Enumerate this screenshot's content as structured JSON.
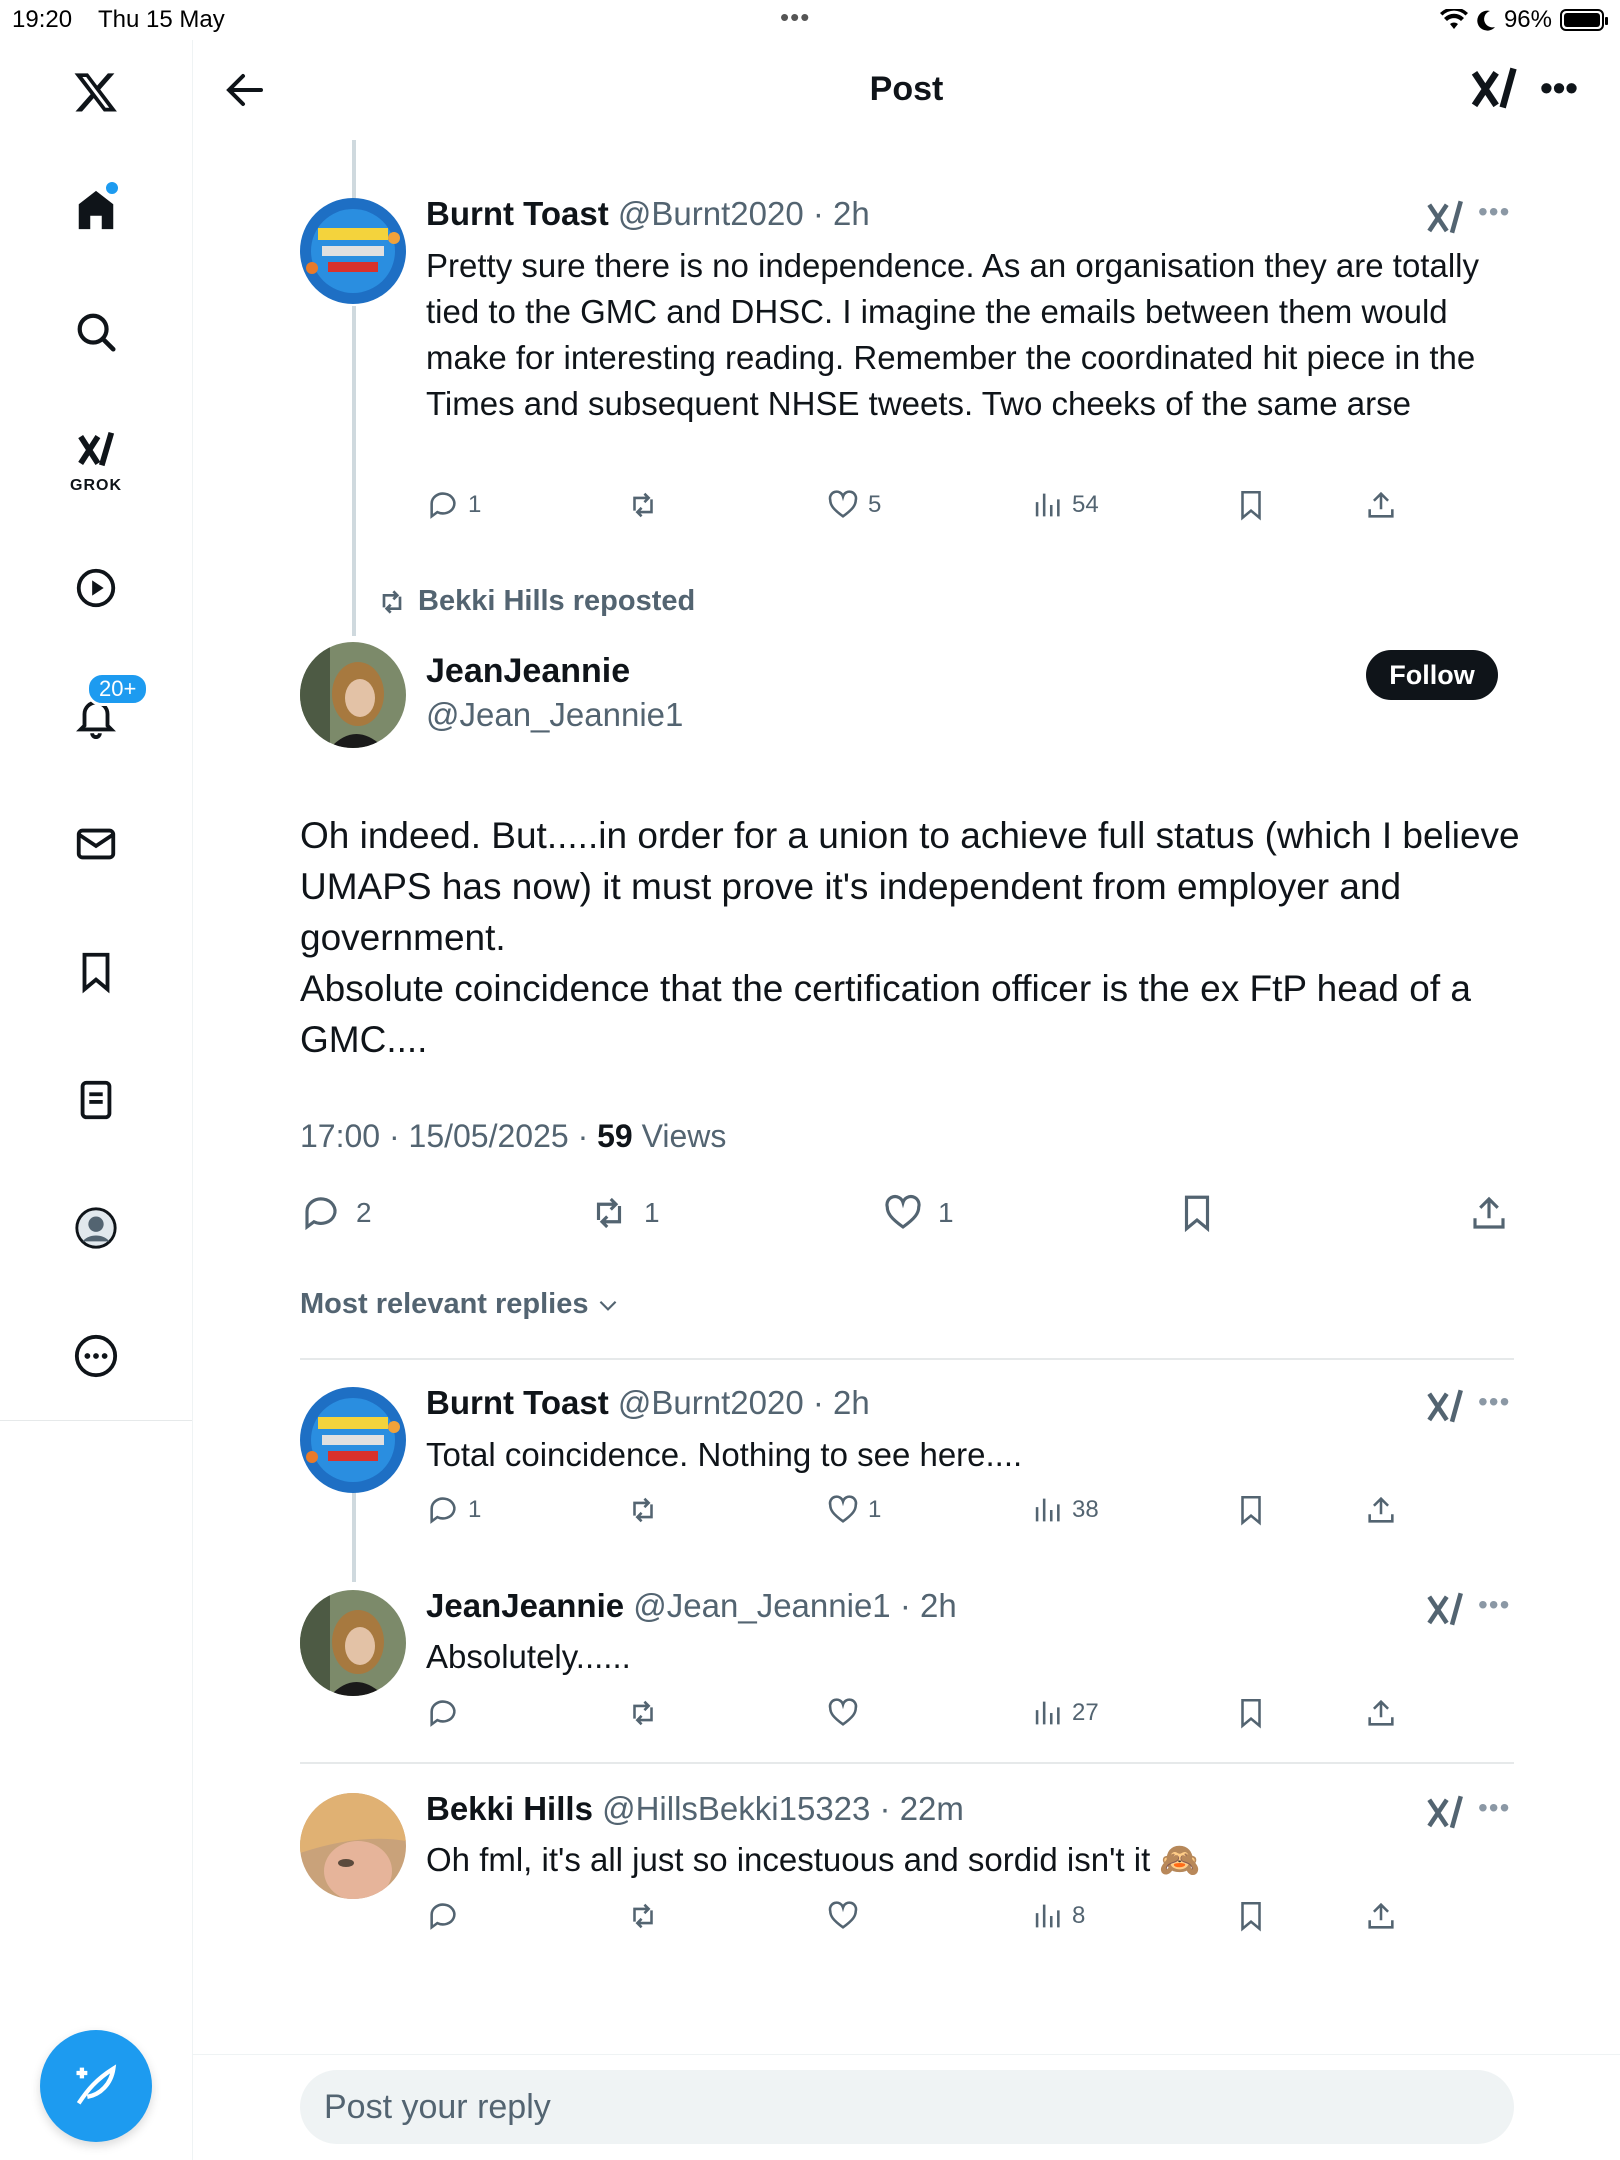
{
  "status_bar": {
    "time": "19:20",
    "date": "Thu 15 May",
    "battery": "96%"
  },
  "header": {
    "title": "Post"
  },
  "sidebar": {
    "grok_label": "GROK",
    "notification_count": "20+"
  },
  "parent_tweet": {
    "name": "Burnt Toast",
    "meta": "@Burnt2020 · 2h",
    "text": "Pretty sure there is no independence. As an organisation they are totally tied to the GMC and DHSC. I imagine the emails between them would make for interesting reading. Remember the coordinated hit piece in the Times and subsequent NHSE tweets. Two cheeks of the same arse",
    "replies": "1",
    "reposts": "",
    "likes": "5",
    "views": "54"
  },
  "repost_banner": "Bekki Hills reposted",
  "main_tweet": {
    "name": "JeanJeannie",
    "handle": "@Jean_Jeannie1",
    "follow_label": "Follow",
    "text_lines": [
      "Oh indeed. But.....in order for a union to achieve full status (which I believe UMAPS has now) it must prove it's  independent from employer and government.",
      "Absolute coincidence that the certification officer is the ex FtP head of a GMC...."
    ],
    "timestamp": "17:00 · 15/05/2025 · ",
    "views_count": "59",
    "views_label": " Views",
    "replies": "2",
    "reposts": "1",
    "likes": "1"
  },
  "sort_label": "Most relevant replies",
  "replies": [
    {
      "name": "Burnt Toast",
      "meta": "@Burnt2020 · 2h",
      "text": "Total coincidence. Nothing to see here....",
      "replies": "1",
      "reposts": "",
      "likes": "1",
      "views": "38"
    },
    {
      "name": "JeanJeannie",
      "meta": "@Jean_Jeannie1 · 2h",
      "text": "Absolutely......",
      "replies": "",
      "reposts": "",
      "likes": "",
      "views": "27"
    },
    {
      "name": "Bekki Hills",
      "meta": "@HillsBekki15323 · 22m",
      "text": "Oh fml, it's all just so incestuous and sordid isn't it 🙈",
      "replies": "",
      "reposts": "",
      "likes": "",
      "views": "8"
    }
  ],
  "composer": {
    "placeholder": "Post your reply"
  }
}
